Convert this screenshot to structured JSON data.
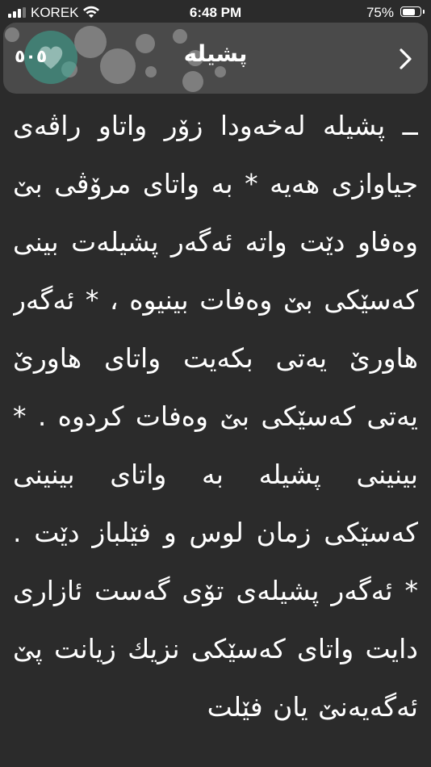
{
  "status_bar": {
    "carrier": "KOREK",
    "time": "6:48 PM",
    "battery_percent": "75%",
    "battery_level": 0.75,
    "signal_bars": 3,
    "icons": [
      "signal-icon",
      "wifi-icon",
      "battery-icon"
    ]
  },
  "nav": {
    "title": "پشیلە",
    "count": "٥٠٥",
    "icons": [
      "heart-icon",
      "chevron-right-icon"
    ]
  },
  "article": {
    "text": "ــ پشیلە لەخەودا زۆر واتاو راڤەی جیاوازی هەیە * بە واتای مرۆڤی بێ وەفاو دێت واتە ئەگەر پشیلەت بینی کەسێکی بێ وەفات بینیوە ، * ئەگەر هاورێ یەتی بکەیت واتای هاورێ یەتی کەسێکی بێ وەفات کردوە . * بینینی پشیلە بە واتای بینینی کەسێکی زمان لوس و فێلباز دێت . * ئەگەر پشیلەی تۆی گەست ئازاری دایت واتای کەسێکی نزیك زیانت پێ ئەگەیەنێ یان فێلت"
  },
  "colors": {
    "background": "#2b2b2b",
    "nav_background": "#4a4a4a",
    "text": "#ffffff",
    "heart_bubble": "#3caa96"
  }
}
